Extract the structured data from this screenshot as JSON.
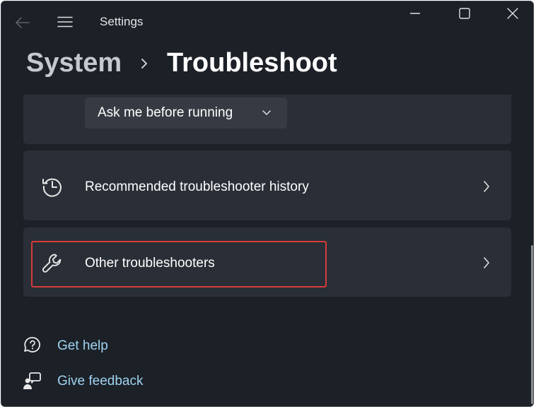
{
  "titlebar": {
    "app_title": "Settings",
    "icons": {
      "back": "back-arrow-icon",
      "menu": "hamburger-menu-icon",
      "minimize": "minimize-icon",
      "maximize": "maximize-icon",
      "close": "close-icon"
    }
  },
  "breadcrumb": {
    "parent": "System",
    "current": "Troubleshoot"
  },
  "recommended_preference": {
    "dropdown_value": "Ask me before running"
  },
  "items": [
    {
      "label": "Recommended troubleshooter history",
      "icon": "history-icon"
    },
    {
      "label": "Other troubleshooters",
      "icon": "wrench-icon"
    }
  ],
  "links": [
    {
      "label": "Get help",
      "icon": "help-chat-icon"
    },
    {
      "label": "Give feedback",
      "icon": "feedback-icon"
    }
  ],
  "colors": {
    "background": "#1c2027",
    "card": "#2a2f37",
    "link": "#9fd3f0",
    "highlight": "#d63a3a"
  }
}
